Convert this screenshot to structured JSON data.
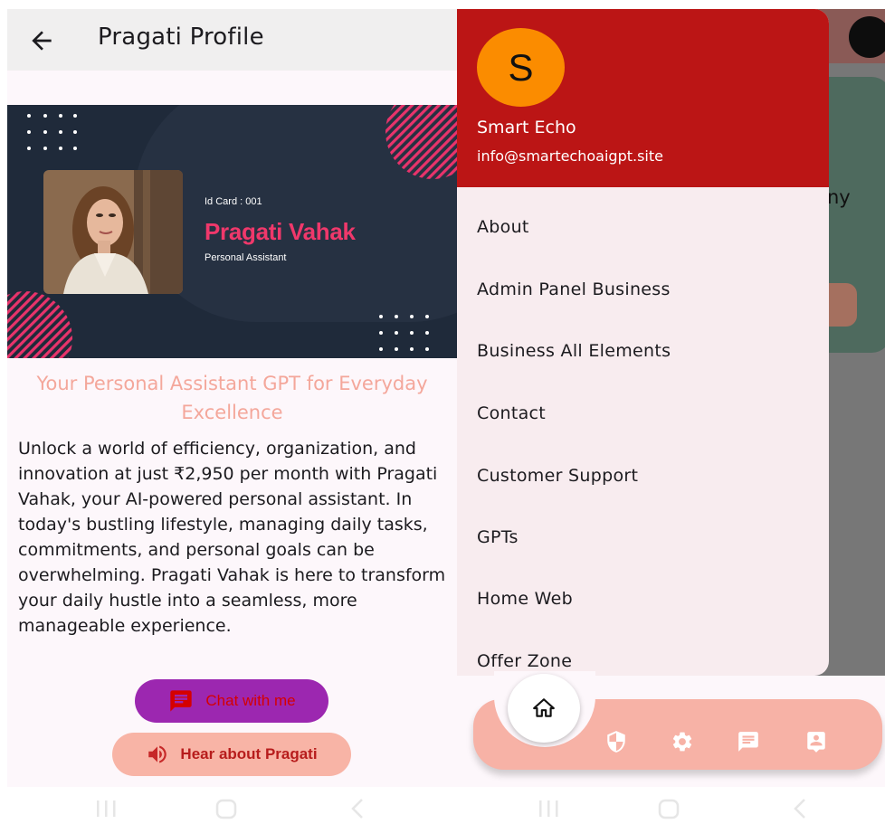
{
  "left_screen": {
    "appbar": {
      "title": "Pragati Profile"
    },
    "banner": {
      "id_card": "Id Card : 001",
      "name": "Pragati Vahak",
      "role": "Personal Assistant"
    },
    "tagline": "Your Personal Assistant GPT for Everyday Excellence",
    "description": "Unlock a world of efficiency, organization, and innovation at just ₹2,950 per month with Pragati Vahak, your AI-powered personal assistant. In today's bustling lifestyle, managing daily tasks, commitments, and personal goals can be overwhelming. Pragati Vahak is here to transform your daily hustle into a seamless, more manageable experience.",
    "buttons": {
      "chat_label": "Chat with me",
      "hear_label": "Hear about Pragati"
    }
  },
  "right_screen": {
    "behind": {
      "partial_text": "ny"
    },
    "drawer": {
      "avatar_letter": "S",
      "name": "Smart Echo",
      "email": "info@smartechoaigpt.site",
      "items": [
        {
          "label": "About"
        },
        {
          "label": "Admin Panel Business"
        },
        {
          "label": "Business All Elements"
        },
        {
          "label": "Contact"
        },
        {
          "label": "Customer Support"
        },
        {
          "label": "GPTs"
        },
        {
          "label": "Home Web"
        },
        {
          "label": "Offer Zone"
        }
      ]
    },
    "bottom_nav": [
      "home-icon",
      "shield-icon",
      "gear-icon",
      "chat-icon",
      "contact-icon"
    ]
  },
  "colors": {
    "drawer_header": "#bb1515",
    "avatar": "#fb8c00",
    "accent_pink": "#f0386b",
    "tagline": "#f4a79b",
    "chat_button": "#9c27b0",
    "hear_button": "#f8b4a6",
    "bottom_bar": "#f7b2a6"
  }
}
